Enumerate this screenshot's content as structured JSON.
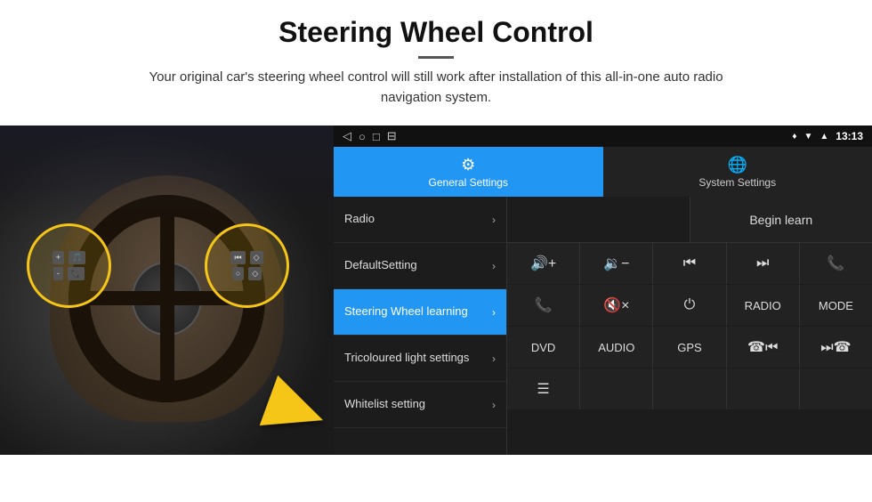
{
  "header": {
    "title": "Steering Wheel Control",
    "description": "Your original car's steering wheel control will still work after installation of this all-in-one auto radio navigation system."
  },
  "status_bar": {
    "location_icon": "♦",
    "signal_icon": "▼",
    "wifi_icon": "▲",
    "time": "13:13"
  },
  "nav_icons": [
    "◁",
    "○",
    "□",
    "⊟"
  ],
  "tabs": [
    {
      "id": "general",
      "label": "General Settings",
      "active": true
    },
    {
      "id": "system",
      "label": "System Settings",
      "active": false
    }
  ],
  "menu_items": [
    {
      "id": "radio",
      "label": "Radio",
      "active": false
    },
    {
      "id": "default",
      "label": "DefaultSetting",
      "active": false
    },
    {
      "id": "steering",
      "label": "Steering Wheel learning",
      "active": true
    },
    {
      "id": "tricoloured",
      "label": "Tricoloured light settings",
      "active": false
    },
    {
      "id": "whitelist",
      "label": "Whitelist setting",
      "active": false
    }
  ],
  "begin_learn_label": "Begin learn",
  "control_buttons": [
    {
      "id": "vol-up",
      "symbol": "🔊+",
      "label": "Volume Up"
    },
    {
      "id": "vol-down",
      "symbol": "🔉-",
      "label": "Volume Down"
    },
    {
      "id": "prev",
      "symbol": "⏮",
      "label": "Previous"
    },
    {
      "id": "next",
      "symbol": "⏭",
      "label": "Next"
    },
    {
      "id": "phone",
      "symbol": "📞",
      "label": "Phone"
    },
    {
      "id": "call",
      "symbol": "📞",
      "label": "Call"
    },
    {
      "id": "mute",
      "symbol": "🔇",
      "label": "Mute"
    },
    {
      "id": "power",
      "symbol": "⏻",
      "label": "Power"
    },
    {
      "id": "radio-btn",
      "label": "RADIO",
      "symbol": "RADIO"
    },
    {
      "id": "mode",
      "label": "MODE",
      "symbol": "MODE"
    },
    {
      "id": "dvd",
      "label": "DVD",
      "symbol": "DVD"
    },
    {
      "id": "audio",
      "label": "AUDIO",
      "symbol": "AUDIO"
    },
    {
      "id": "gps",
      "label": "GPS",
      "symbol": "GPS"
    },
    {
      "id": "phone2",
      "symbol": "☎⏮",
      "label": "Phone Prev"
    },
    {
      "id": "next2",
      "symbol": "⏭☎",
      "label": "Next Skip"
    },
    {
      "id": "playlist",
      "symbol": "≡",
      "label": "Playlist"
    }
  ]
}
